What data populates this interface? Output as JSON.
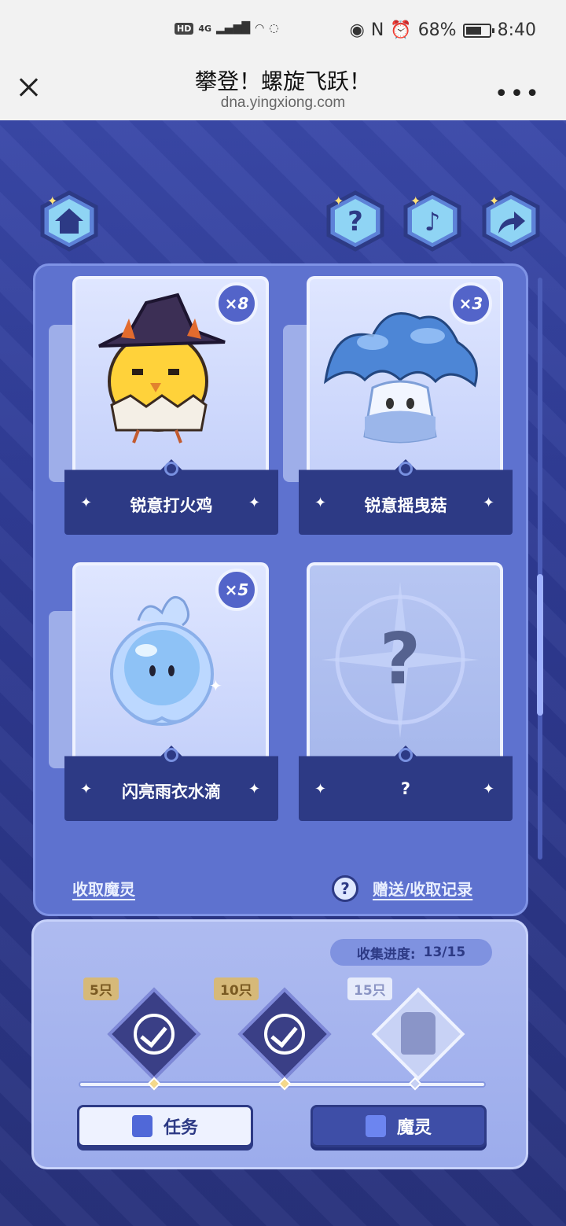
{
  "status_bar": {
    "hd": "HD",
    "network": "4G",
    "battery": "68%",
    "battery_level": 0.68,
    "time": "8:40"
  },
  "browser": {
    "title": "攀登！螺旋飞跃！",
    "url": "dna.yingxiong.com",
    "more": "•••"
  },
  "icons": {
    "home": "home-icon",
    "help": "help-icon",
    "music": "music-icon",
    "share": "share-icon"
  },
  "cards": [
    {
      "name": "锐意打火鸡",
      "count": "×8",
      "locked": false,
      "art": "chick-witch-hat"
    },
    {
      "name": "锐意摇曳菇",
      "count": "×3",
      "locked": false,
      "art": "blue-mushroom"
    },
    {
      "name": "闪亮雨衣水滴",
      "count": "×5",
      "locked": false,
      "art": "water-drop"
    },
    {
      "name": "?",
      "count": "",
      "locked": true,
      "art": "unknown"
    }
  ],
  "links": {
    "collect": "收取魔灵",
    "help_mark": "?",
    "records": "赠送/收取记录"
  },
  "progress": {
    "label": "收集进度:",
    "value": "13/15",
    "current": 13,
    "total": 15
  },
  "rewards": [
    {
      "label": "5只",
      "claimed": true
    },
    {
      "label": "10只",
      "claimed": true
    },
    {
      "label": "15只",
      "claimed": false
    }
  ],
  "buttons": {
    "task": "任务",
    "spirit": "魔灵"
  },
  "colors": {
    "panel": "#5e72cf",
    "dark_plate": "#2d3a85",
    "background": "#2e3a92"
  }
}
